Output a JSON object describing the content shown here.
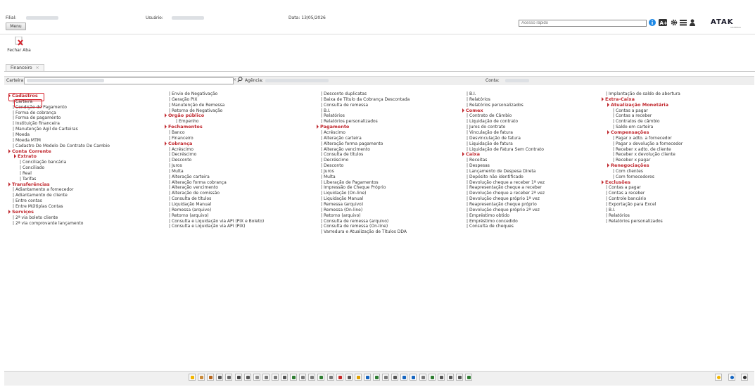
{
  "header": {
    "filial_label": "Filial:",
    "usuario_label": "Usuário:",
    "data_label": "Data: 13/05/2026",
    "menu_button": "Menu",
    "quick_access_placeholder": "Acesso rápido",
    "logo": "ATAK",
    "logo_sub": "SISTEMAS"
  },
  "toolbar": {
    "fechar_aba": "Fechar Aba"
  },
  "tabs": [
    {
      "label": "Financeiro",
      "close": "×"
    }
  ],
  "filters": {
    "carteira_label": "Carteira:",
    "agencia_label": "Agência:",
    "conta_label": "Conta:"
  },
  "columns": [
    {
      "entries": [
        {
          "type": "section",
          "text": "Cadastros"
        },
        {
          "type": "item",
          "text": "Carteira"
        },
        {
          "type": "item",
          "text": "Condição de Pagamento"
        },
        {
          "type": "item",
          "text": "Forma de cobrança"
        },
        {
          "type": "item",
          "text": "Forma de pagamento"
        },
        {
          "type": "item",
          "text": "Instituição financeira"
        },
        {
          "type": "item",
          "text": "Manutenção Agil de Carteiras"
        },
        {
          "type": "item",
          "text": "Moeda"
        },
        {
          "type": "item",
          "text": "Moeda MTM"
        },
        {
          "type": "item",
          "text": "Cadastro De Modelo De Contrato De Cambio"
        },
        {
          "type": "section",
          "text": "Conta Corrente"
        },
        {
          "type": "subsection",
          "text": "Extrato"
        },
        {
          "type": "subitem",
          "text": "Conciliação bancária"
        },
        {
          "type": "subitem",
          "text": "Conciliado"
        },
        {
          "type": "subitem",
          "text": "Real"
        },
        {
          "type": "subitem",
          "text": "Tarifas"
        },
        {
          "type": "section",
          "text": "Transferências"
        },
        {
          "type": "item",
          "text": "Adiantamento a fornecedor"
        },
        {
          "type": "item",
          "text": "Adiantamento de cliente"
        },
        {
          "type": "item",
          "text": "Entre contas"
        },
        {
          "type": "item",
          "text": "Entre Múltiplas Contas"
        },
        {
          "type": "section",
          "text": "Serviços"
        },
        {
          "type": "item",
          "text": "2ª via boleto cliente"
        },
        {
          "type": "item",
          "text": "2ª via comprovante lançamento"
        }
      ]
    },
    {
      "entries": [
        {
          "type": "item",
          "text": "Envio de Negativação"
        },
        {
          "type": "item",
          "text": "Geração PIX"
        },
        {
          "type": "item",
          "text": "Manutenção de Remessa"
        },
        {
          "type": "item",
          "text": "Retorno de Negativação"
        },
        {
          "type": "section",
          "text": "Orgão público"
        },
        {
          "type": "subitem",
          "text": "Empenho"
        },
        {
          "type": "section",
          "text": "Fechamentos"
        },
        {
          "type": "item",
          "text": "Banco"
        },
        {
          "type": "item",
          "text": "Financeiro"
        },
        {
          "type": "section",
          "text": "Cobrança"
        },
        {
          "type": "item",
          "text": "Acréscimo"
        },
        {
          "type": "item",
          "text": "Decréscimo"
        },
        {
          "type": "item",
          "text": "Desconto"
        },
        {
          "type": "item",
          "text": "Juros"
        },
        {
          "type": "item",
          "text": "Multa"
        },
        {
          "type": "item",
          "text": "Alteração carteira"
        },
        {
          "type": "item",
          "text": "Alteração forma cobrança"
        },
        {
          "type": "item",
          "text": "Alteração vencimento"
        },
        {
          "type": "item",
          "text": "Alteração de comissão"
        },
        {
          "type": "item",
          "text": "Consulta de títulos"
        },
        {
          "type": "item",
          "text": "Liquidação Manual"
        },
        {
          "type": "item",
          "text": "Remessa (arquivo)"
        },
        {
          "type": "item",
          "text": "Retorno (arquivo)"
        },
        {
          "type": "item",
          "text": "Consulta e Liquidação via API (PIX e Boleto)"
        },
        {
          "type": "item",
          "text": "Consulta e Liquidação via API (PIX)"
        }
      ]
    },
    {
      "entries": [
        {
          "type": "item",
          "text": "Desconto duplicatas"
        },
        {
          "type": "item",
          "text": "Baixa de Título da Cobrança Descontada"
        },
        {
          "type": "item",
          "text": "Consulta de remessa"
        },
        {
          "type": "item",
          "text": "B.I."
        },
        {
          "type": "item",
          "text": "Relatórios"
        },
        {
          "type": "item",
          "text": "Relatórios personalizados"
        },
        {
          "type": "section",
          "text": "Pagamento"
        },
        {
          "type": "item",
          "text": "Acréscimo"
        },
        {
          "type": "item",
          "text": "Alteração carteira"
        },
        {
          "type": "item",
          "text": "Alteração forma pagamento"
        },
        {
          "type": "item",
          "text": "Alteração vencimento"
        },
        {
          "type": "item",
          "text": "Consulta de títulos"
        },
        {
          "type": "item",
          "text": "Decréscimo"
        },
        {
          "type": "item",
          "text": "Desconto"
        },
        {
          "type": "item",
          "text": "Juros"
        },
        {
          "type": "item",
          "text": "Multa"
        },
        {
          "type": "item",
          "text": "Liberação de Pagamentos"
        },
        {
          "type": "item",
          "text": "Impressão de Cheque Próprio"
        },
        {
          "type": "item",
          "text": "Liquidação (On-line)"
        },
        {
          "type": "item",
          "text": "Liquidação Manual"
        },
        {
          "type": "item",
          "text": "Remessa (arquivo)"
        },
        {
          "type": "item",
          "text": "Remessa (On-line)"
        },
        {
          "type": "item",
          "text": "Retorno (arquivo)"
        },
        {
          "type": "item",
          "text": "Consulta de remessa (arquivo)"
        },
        {
          "type": "item",
          "text": "Consulta de remessa (On-line)"
        },
        {
          "type": "item",
          "text": "Varredura e Atualização de Títulos DDA"
        }
      ]
    },
    {
      "entries": [
        {
          "type": "item",
          "text": "B.I."
        },
        {
          "type": "item",
          "text": "Relatórios"
        },
        {
          "type": "item",
          "text": "Relatórios personalizados"
        },
        {
          "type": "section",
          "text": "Comex"
        },
        {
          "type": "item",
          "text": "Contrato de Câmbio"
        },
        {
          "type": "item",
          "text": "Liquidação de contrato"
        },
        {
          "type": "item",
          "text": "Juros do contrato"
        },
        {
          "type": "item",
          "text": "Vinculação de fatura"
        },
        {
          "type": "item",
          "text": "Desvinculação de fatura"
        },
        {
          "type": "item",
          "text": "Liquidação de fatura"
        },
        {
          "type": "item",
          "text": "Liquidação de Fatura Sem Contrato"
        },
        {
          "type": "section",
          "text": "Caixa"
        },
        {
          "type": "item",
          "text": "Receitas"
        },
        {
          "type": "item",
          "text": "Despesas"
        },
        {
          "type": "item",
          "text": "Lançamento de Despesa Direta"
        },
        {
          "type": "item",
          "text": "Depósito não identificado"
        },
        {
          "type": "item",
          "text": "Devolução cheque a receber 1ª vez"
        },
        {
          "type": "item",
          "text": "Reapresentação cheque a receber"
        },
        {
          "type": "item",
          "text": "Devolução cheque a receber 2ª vez"
        },
        {
          "type": "item",
          "text": "Devolução cheque próprio 1ª vez"
        },
        {
          "type": "item",
          "text": "Reapresentação cheque próprio"
        },
        {
          "type": "item",
          "text": "Devolução cheque próprio 2ª vez"
        },
        {
          "type": "item",
          "text": "Empréstimo obtido"
        },
        {
          "type": "item",
          "text": "Empréstimo concedido"
        },
        {
          "type": "item",
          "text": "Consulta de cheques"
        }
      ]
    },
    {
      "entries": [
        {
          "type": "item",
          "text": "Implantação de saldo de abertura"
        },
        {
          "type": "section",
          "text": "Extra-Caixa"
        },
        {
          "type": "subsection",
          "text": "Atualização Monetária"
        },
        {
          "type": "subitem",
          "text": "Contas a pagar"
        },
        {
          "type": "subitem",
          "text": "Contas a receber"
        },
        {
          "type": "subitem",
          "text": "Contratos de câmbio"
        },
        {
          "type": "subitem",
          "text": "Saldo em carteira"
        },
        {
          "type": "subsection",
          "text": "Compensações"
        },
        {
          "type": "subitem",
          "text": "Pagar x adto. a fornecedor"
        },
        {
          "type": "subitem",
          "text": "Pagar x devolução a fornecedor"
        },
        {
          "type": "subitem",
          "text": "Receber x adto. de cliente"
        },
        {
          "type": "subitem",
          "text": "Receber x devolução cliente"
        },
        {
          "type": "subitem",
          "text": "Receber x pagar"
        },
        {
          "type": "subsection",
          "text": "Renegociações"
        },
        {
          "type": "subitem",
          "text": "Com clientes"
        },
        {
          "type": "subitem",
          "text": "Com fornecedores"
        },
        {
          "type": "section",
          "text": "Exclusões"
        },
        {
          "type": "item",
          "text": "Contas a pagar"
        },
        {
          "type": "item",
          "text": "Contas a receber"
        },
        {
          "type": "item",
          "text": "Controle bancário"
        },
        {
          "type": "item",
          "text": "Exportação para Excel"
        },
        {
          "type": "item",
          "text": "B.I."
        },
        {
          "type": "item",
          "text": "Relatórios"
        },
        {
          "type": "item",
          "text": "Relatórios personalizados"
        }
      ]
    }
  ],
  "top_icons": [
    {
      "name": "info-icon",
      "color": "#1e88e5"
    },
    {
      "name": "font-size-icon",
      "color": "#333333"
    },
    {
      "name": "gear-icon",
      "color": "#333333"
    },
    {
      "name": "list-icon",
      "color": "#333333"
    },
    {
      "name": "user-icon",
      "color": "#333333"
    }
  ],
  "bottom_icons": [
    {
      "name": "star-icon",
      "color": "#f2b600"
    },
    {
      "name": "people-icon",
      "color": "#c98a3a"
    },
    {
      "name": "briefcase-icon",
      "color": "#b5651d"
    },
    {
      "name": "calculator-icon",
      "color": "#555555"
    },
    {
      "name": "document-icon",
      "color": "#666666"
    },
    {
      "name": "bank-icon",
      "color": "#444444"
    },
    {
      "name": "target-icon",
      "color": "#555555"
    },
    {
      "name": "clip-icon",
      "color": "#888888"
    },
    {
      "name": "printer-icon",
      "color": "#777777"
    },
    {
      "name": "report-icon",
      "color": "#777777"
    },
    {
      "name": "chart-icon",
      "color": "#555555"
    },
    {
      "name": "globe-icon",
      "color": "#2e7d32"
    },
    {
      "name": "trash-icon",
      "color": "#777777"
    },
    {
      "name": "card-icon",
      "color": "#777777"
    },
    {
      "name": "dollar-icon",
      "color": "#2e7d32"
    },
    {
      "name": "table-icon",
      "color": "#777777"
    },
    {
      "name": "bar-chart-icon",
      "color": "#c62828"
    },
    {
      "name": "presentation-icon",
      "color": "#555555"
    },
    {
      "name": "pencil-icon",
      "color": "#e0a000"
    },
    {
      "name": "receipt-icon",
      "color": "#1565c0"
    },
    {
      "name": "box-icon",
      "color": "#2e7d32"
    },
    {
      "name": "clipboard-icon",
      "color": "#777777"
    },
    {
      "name": "window-icon",
      "color": "#555555"
    },
    {
      "name": "diamond-icon",
      "color": "#1565c0"
    },
    {
      "name": "line-chart-icon",
      "color": "#1565c0"
    },
    {
      "name": "table2-icon",
      "color": "#777777"
    },
    {
      "name": "money-icon",
      "color": "#2e7d32"
    },
    {
      "name": "cart-icon",
      "color": "#555555"
    },
    {
      "name": "tree-icon",
      "color": "#555555"
    },
    {
      "name": "refresh-icon",
      "color": "#555555"
    },
    {
      "name": "group-icon",
      "color": "#2e7d32"
    }
  ],
  "bottom_right_icons": [
    {
      "name": "star-fav-icon",
      "color": "#f2b600"
    },
    {
      "name": "help-icon",
      "color": "#1565c0"
    },
    {
      "name": "window-toggle-icon",
      "color": "#333333"
    }
  ]
}
